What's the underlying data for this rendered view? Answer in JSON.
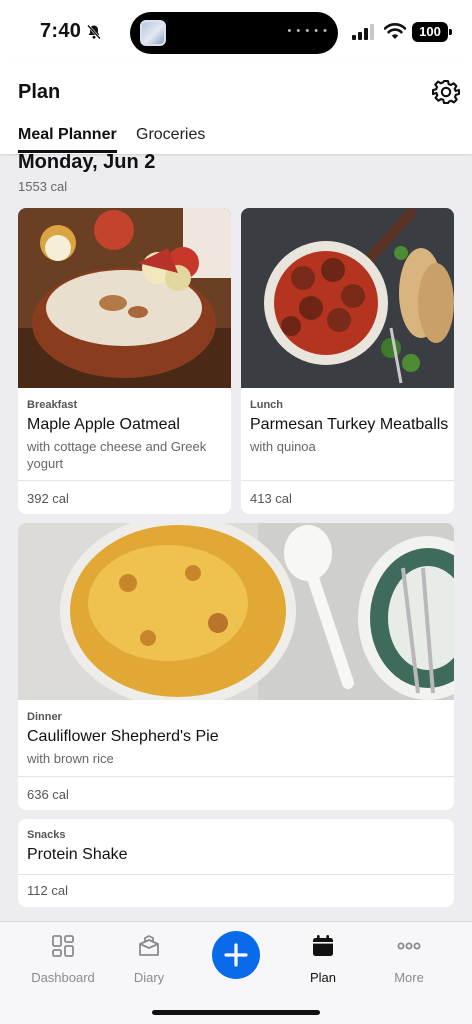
{
  "status_bar": {
    "time": "7:40",
    "battery": "100"
  },
  "header": {
    "title": "Plan",
    "tabs": [
      "Meal Planner",
      "Groceries"
    ]
  },
  "day": {
    "title": "Monday, Jun 2",
    "calories": "1553 cal"
  },
  "meals": [
    {
      "label": "Breakfast",
      "name": "Maple Apple Oatmeal",
      "side": "with cottage cheese and Greek yogurt",
      "calories": "392 cal"
    },
    {
      "label": "Lunch",
      "name": "Parmesan Turkey Meatballs",
      "side": "with quinoa",
      "calories": "413 cal"
    },
    {
      "label": "Dinner",
      "name": "Cauliflower Shepherd's Pie",
      "side": "with brown rice",
      "calories": "636 cal"
    },
    {
      "label": "Snacks",
      "name": "Protein Shake",
      "calories": "112 cal"
    }
  ],
  "bottom_nav": {
    "items": [
      {
        "label": "Dashboard",
        "icon": "dashboard-icon"
      },
      {
        "label": "Diary",
        "icon": "diary-icon"
      },
      {
        "label": "Plan",
        "icon": "calendar-icon"
      },
      {
        "label": "More",
        "icon": "more-icon"
      }
    ],
    "active": "Plan",
    "add_icon": "plus-icon"
  },
  "colors": {
    "accent": "#0A6BEA",
    "background": "#ECECF1"
  }
}
